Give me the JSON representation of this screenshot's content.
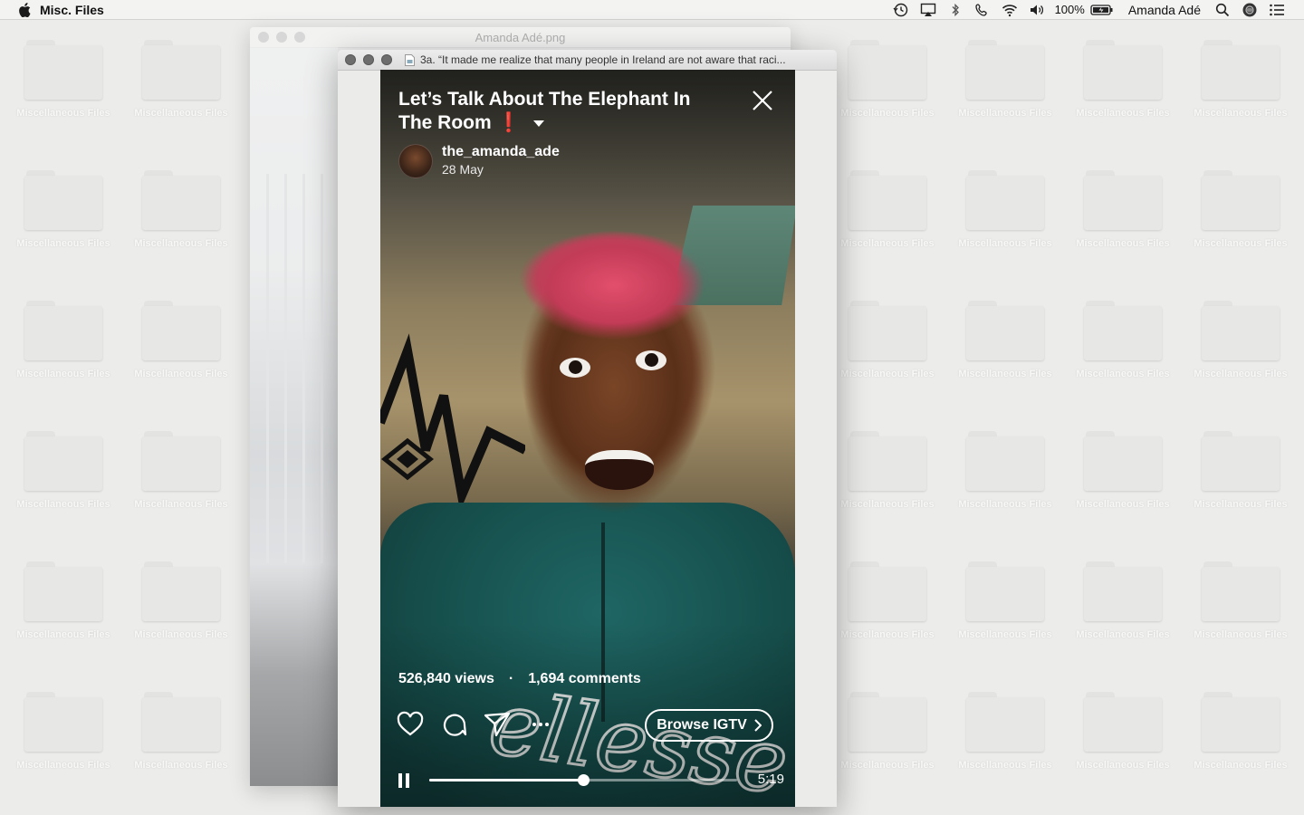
{
  "menubar": {
    "app_name": "Misc. Files",
    "battery_percent": "100%",
    "user_name": "Amanda Adé",
    "status_icons": [
      "time-machine-icon",
      "airplay-icon",
      "bluetooth-icon",
      "phone-icon",
      "wifi-icon",
      "volume-icon",
      "battery-icon",
      "spotlight-icon",
      "siri-icon",
      "notification-center-icon"
    ]
  },
  "desktop": {
    "folder_label": "Miscellaneous Files"
  },
  "background_window": {
    "title": "Amanda Adé.png"
  },
  "preview_window": {
    "title": "3a. “It made me realize that many people in Ireland are not aware that raci..."
  },
  "igtv": {
    "title": "Let’s Talk About The Elephant In The Room",
    "title_emoji": "❗",
    "username": "the_amanda_ade",
    "date": "28 May",
    "views": "526,840 views",
    "separator": "·",
    "comments": "1,694 comments",
    "browse_label": "Browse IGTV",
    "duration": "5:19",
    "progress": 0.5
  }
}
